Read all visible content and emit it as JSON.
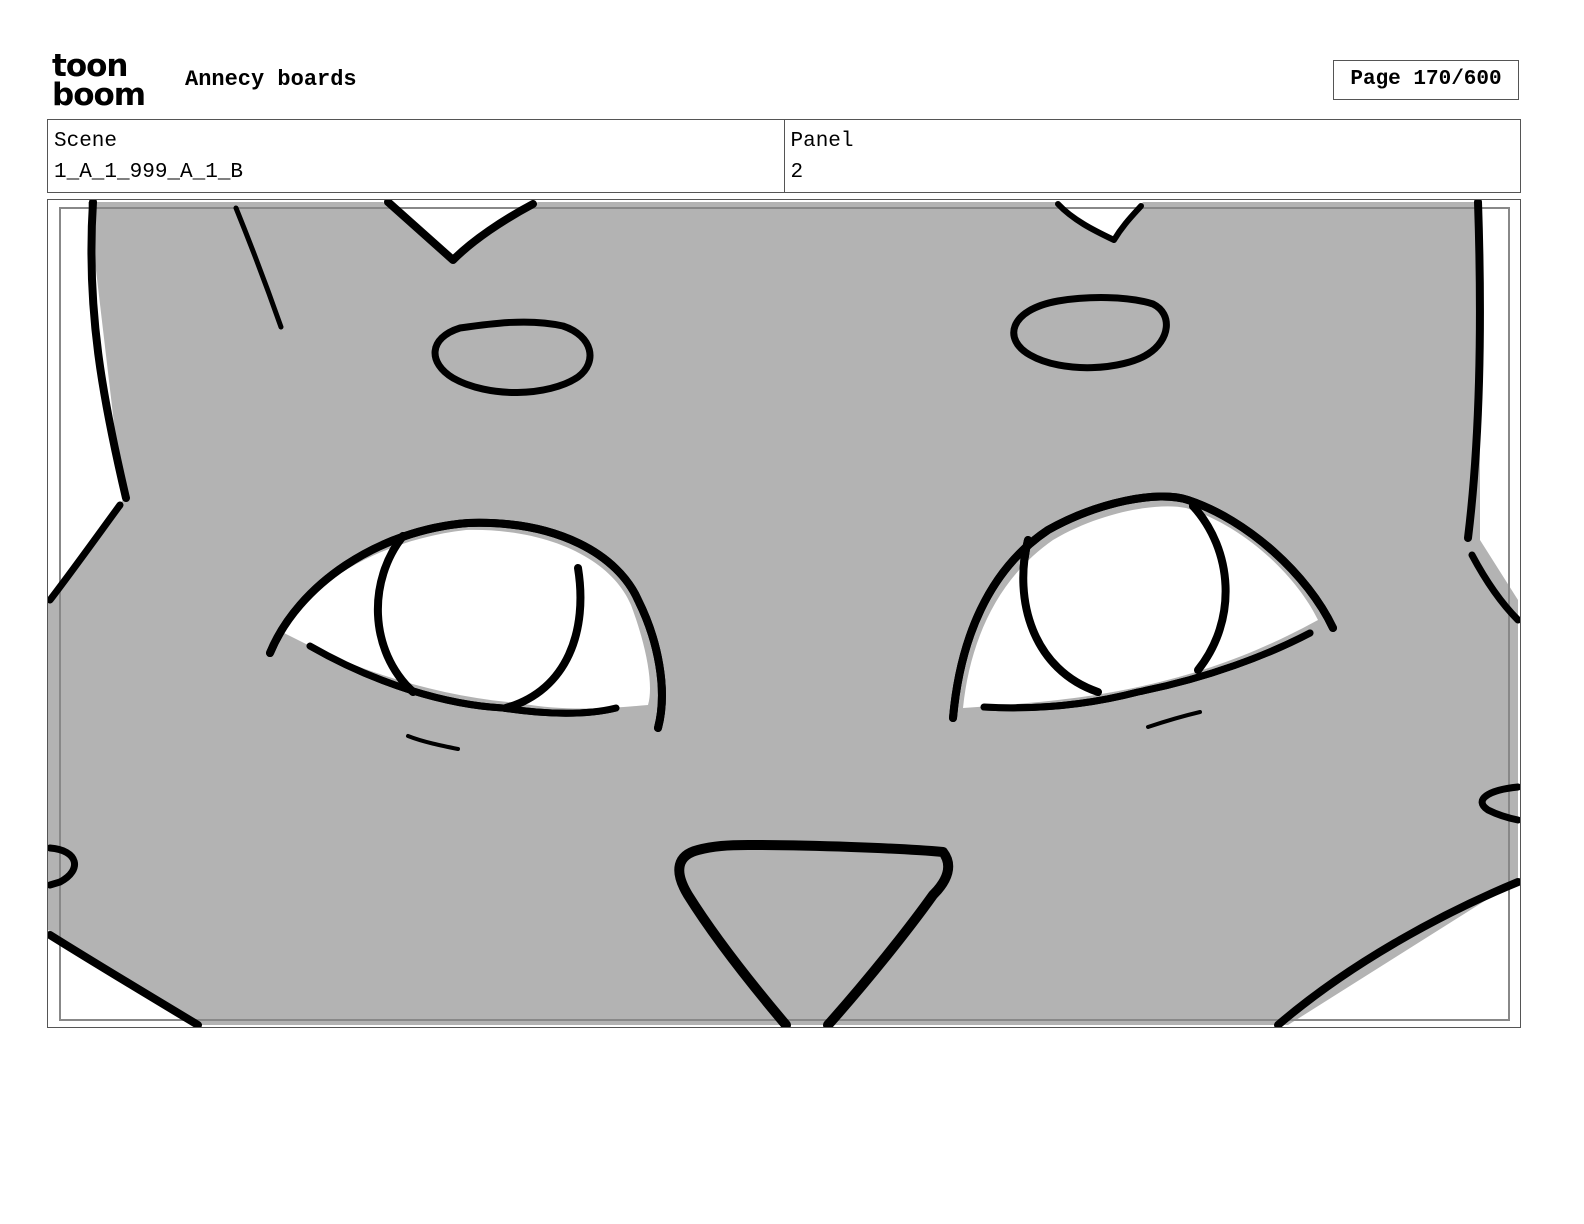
{
  "header": {
    "logo": {
      "line1": "toon",
      "line2": "boom"
    },
    "title": "Annecy boards",
    "page_counter": "Page 170/600"
  },
  "info": {
    "scene_label": "Scene",
    "scene_value": "1_A_1_999_A_1_B",
    "panel_label": "Panel",
    "panel_value": "2"
  },
  "colors": {
    "fill": "#b3b3b3",
    "ink": "#000000",
    "paper": "#ffffff",
    "frame": "#555555"
  }
}
